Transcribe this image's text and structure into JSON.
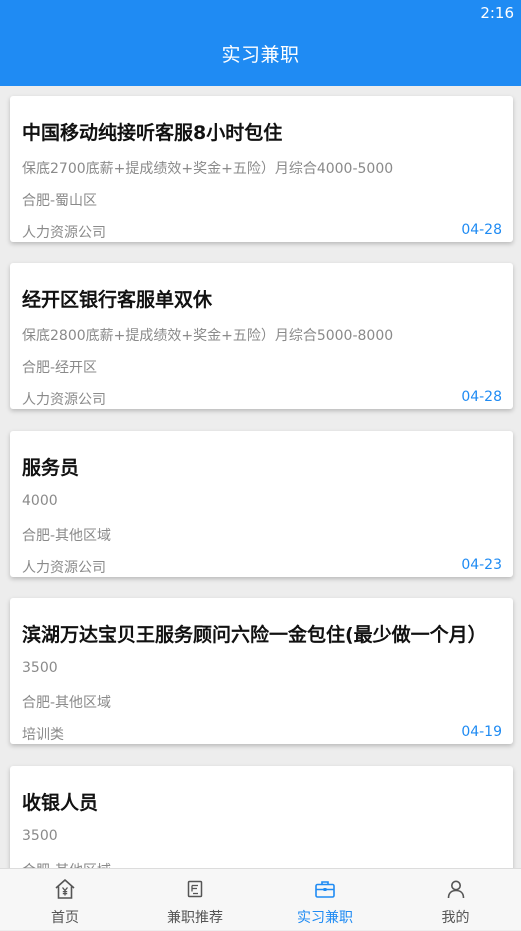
{
  "status_bar": {
    "time": "2:16"
  },
  "header": {
    "title": "实习兼职"
  },
  "jobs": [
    {
      "title": "中国移动纯接听客服8小时包住",
      "salary": "保底2700底薪+提成绩效+奖金+五险）月综合4000-5000",
      "location": "合肥-蜀山区",
      "company": "人力资源公司",
      "date": "04-28"
    },
    {
      "title": "经开区银行客服单双休",
      "salary": "保底2800底薪+提成绩效+奖金+五险）月综合5000-8000",
      "location": "合肥-经开区",
      "company": "人力资源公司",
      "date": "04-28"
    },
    {
      "title": "服务员",
      "salary": "4000",
      "location": "合肥-其他区域",
      "company": "人力资源公司",
      "date": "04-23"
    },
    {
      "title": "滨湖万达宝贝王服务顾问六险一金包住(最少做一个月）",
      "salary": "3500",
      "location": "合肥-其他区域",
      "company": "培训类",
      "date": "04-19"
    },
    {
      "title": "收银人员",
      "salary": "3500",
      "location": "合肥-其他区域",
      "company": "",
      "date": ""
    }
  ],
  "tabbar": {
    "items": [
      {
        "label": "首页",
        "icon": "home-yen-icon"
      },
      {
        "label": "兼职推荐",
        "icon": "recommend-icon"
      },
      {
        "label": "实习兼职",
        "icon": "briefcase-icon"
      },
      {
        "label": "我的",
        "icon": "user-icon"
      }
    ],
    "active_index": 2
  },
  "colors": {
    "primary": "#1f8bf3",
    "background": "#ededed",
    "card": "#ffffff",
    "muted_text": "#8a8a8a"
  }
}
